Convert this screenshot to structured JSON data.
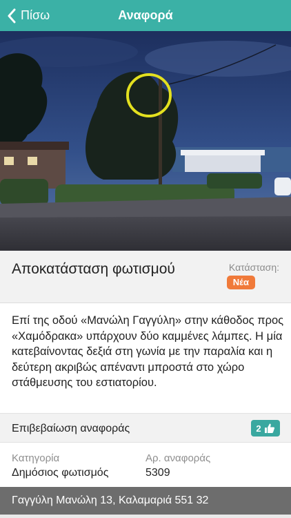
{
  "navbar": {
    "back_label": "Πίσω",
    "title": "Αναφορά",
    "accent_color": "#3bb1a6"
  },
  "report": {
    "title": "Αποκατάσταση φωτισμού",
    "status_label": "Κατάσταση:",
    "status_value": "Νέα",
    "status_color": "#f07a3a",
    "description": "Επί της οδού «Μανώλη Γαγγύλη» στην κάθοδος προς «Χαμόδρακα» υπάρχουν δύο καμμένες λάμπες. Η μία κατεβαίνοντας δεξιά στη γωνία με την παραλία και η δεύτερη ακριβώς απέναντι μπροστά στο χώρο στάθμευσης του εστιατορίου."
  },
  "confirm": {
    "label": "Επιβεβαίωση αναφοράς",
    "count": "2",
    "icon": "thumbs-up-icon"
  },
  "info": {
    "category_label": "Κατηγορία",
    "category_value": "Δημόσιος φωτισμός",
    "number_label": "Αρ. αναφοράς",
    "number_value": "5309"
  },
  "address": "Γαγγύλη Μανώλη 13, Καλαμαριά 551 32"
}
